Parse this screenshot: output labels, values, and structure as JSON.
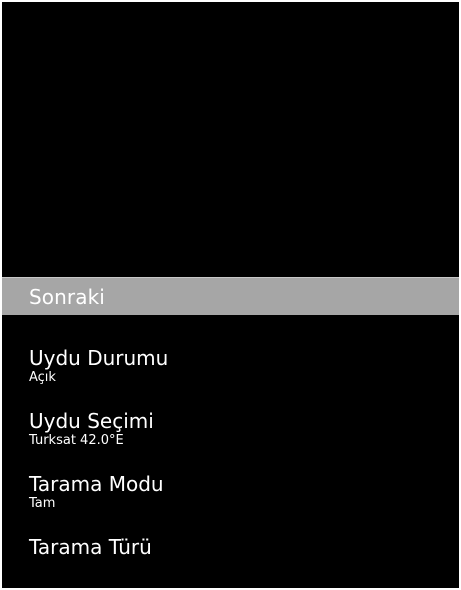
{
  "menu": {
    "next_label": "Sonraki",
    "settings": [
      {
        "label": "Uydu Durumu",
        "value": "Açık"
      },
      {
        "label": "Uydu Seçimi",
        "value": "Turksat 42.0°E"
      },
      {
        "label": "Tarama Modu",
        "value": "Tam"
      },
      {
        "label": "Tarama Türü",
        "value": ""
      }
    ]
  },
  "colors": {
    "background": "#000000",
    "highlight": "#a6a6a6",
    "text": "#ffffff"
  }
}
